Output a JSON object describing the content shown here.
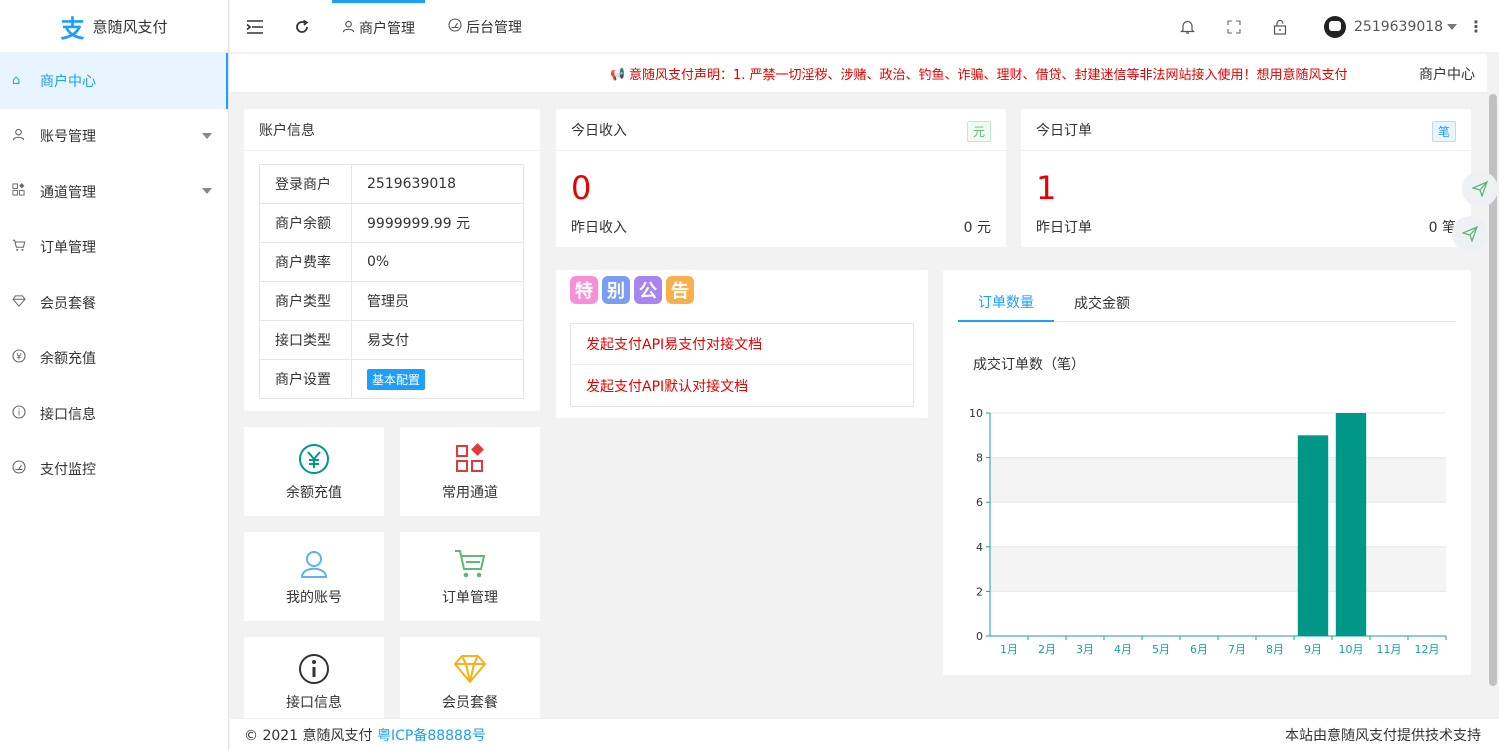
{
  "brand": {
    "logo_char": "支",
    "name": "意随风支付"
  },
  "sidebar": {
    "items": [
      {
        "label": "商户中心",
        "icon": "home-icon",
        "active": true
      },
      {
        "label": "账号管理",
        "icon": "user-icon",
        "has_submenu": true
      },
      {
        "label": "通道管理",
        "icon": "apps-icon",
        "has_submenu": true
      },
      {
        "label": "订单管理",
        "icon": "cart-icon"
      },
      {
        "label": "会员套餐",
        "icon": "diamond-icon"
      },
      {
        "label": "余额充值",
        "icon": "yen-icon"
      },
      {
        "label": "接口信息",
        "icon": "info-icon"
      },
      {
        "label": "支付监控",
        "icon": "gauge-icon"
      }
    ]
  },
  "header": {
    "tabs": [
      {
        "label": "商户管理",
        "icon": "user-icon",
        "active": true
      },
      {
        "label": "后台管理",
        "icon": "gauge-icon"
      }
    ],
    "username": "2519639018"
  },
  "notice": {
    "text": "意随风支付声明：1. 严禁一切淫秽、涉赌、政治、钓鱼、诈骗、理财、借贷、封建迷信等非法网站接入使用！想用意随风支付",
    "breadcrumb": "商户中心"
  },
  "account": {
    "title": "账户信息",
    "rows": [
      {
        "k": "登录商户",
        "v": "2519639018"
      },
      {
        "k": "商户余额",
        "v": "9999999.99 元"
      },
      {
        "k": "商户费率",
        "v": "0%"
      },
      {
        "k": "商户类型",
        "v": "管理员"
      },
      {
        "k": "接口类型",
        "v": "易支付"
      },
      {
        "k": "商户设置",
        "v": "基本配置"
      }
    ]
  },
  "quick": [
    {
      "label": "余额充值",
      "icon": "yen-circle-icon"
    },
    {
      "label": "常用通道",
      "icon": "apps-icon"
    },
    {
      "label": "我的账号",
      "icon": "user-icon"
    },
    {
      "label": "订单管理",
      "icon": "cart-icon"
    },
    {
      "label": "接口信息",
      "icon": "info-circle-icon"
    },
    {
      "label": "会员套餐",
      "icon": "diamond-icon"
    }
  ],
  "stats": {
    "income": {
      "title": "今日收入",
      "tag": "元",
      "value": "0",
      "y_label": "昨日收入",
      "y_value": "0 元"
    },
    "orders": {
      "title": "今日订单",
      "tag": "笔",
      "value": "1",
      "y_label": "昨日订单",
      "y_value": "0 笔"
    }
  },
  "announce": {
    "title_chars": [
      "特",
      "别",
      "公",
      "告"
    ],
    "links": [
      "发起支付API易支付对接文档",
      "发起支付API默认对接文档"
    ]
  },
  "chart_tabs": [
    "订单数量",
    "成交金额"
  ],
  "chart_data": {
    "type": "bar",
    "title": "成交订单数（笔）",
    "categories": [
      "1月",
      "2月",
      "3月",
      "4月",
      "5月",
      "6月",
      "7月",
      "8月",
      "9月",
      "10月",
      "11月",
      "12月"
    ],
    "values": [
      0,
      0,
      0,
      0,
      0,
      0,
      0,
      0,
      9,
      10,
      0,
      0
    ],
    "ylim": [
      0,
      10
    ],
    "yticks": [
      0,
      2,
      4,
      6,
      8,
      10
    ],
    "color": "#009688",
    "axis_color": "#1aa094"
  },
  "footer": {
    "copyright": "© 2021 意随风支付",
    "icp": "粤ICP备88888号",
    "right": "本站由意随风支付提供技术支持"
  }
}
